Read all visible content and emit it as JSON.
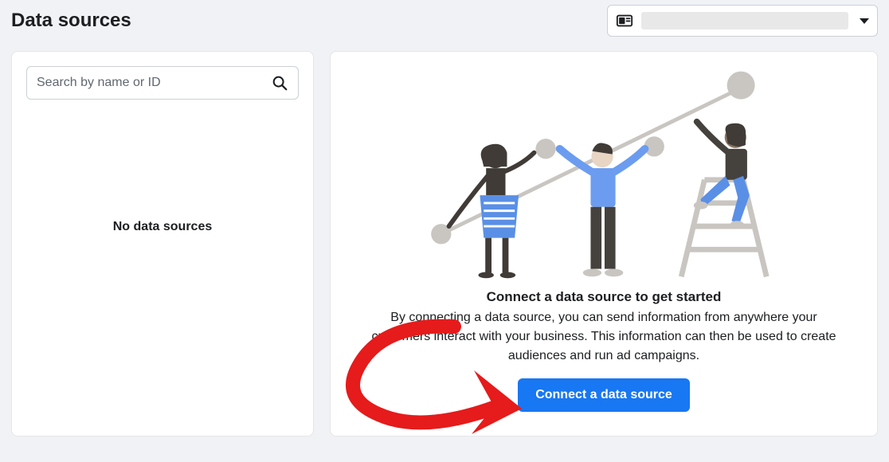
{
  "header": {
    "title": "Data sources"
  },
  "search": {
    "placeholder": "Search by name or ID"
  },
  "leftPanel": {
    "emptyStateText": "No data sources"
  },
  "rightPanel": {
    "heading": "Connect a data source to get started",
    "description": "By connecting a data source, you can send information from anywhere your customers interact with your business. This information can then be used to create audiences and run ad campaigns.",
    "buttonLabel": "Connect a data source"
  }
}
